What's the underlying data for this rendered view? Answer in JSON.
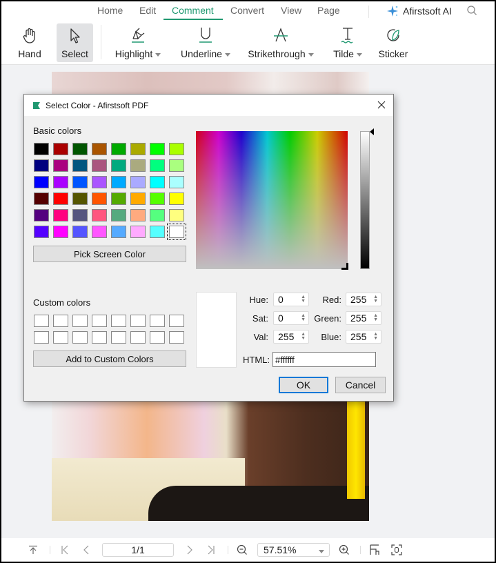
{
  "menu_tabs": [
    {
      "label": "Home",
      "active": false
    },
    {
      "label": "Edit",
      "active": false
    },
    {
      "label": "Comment",
      "active": true
    },
    {
      "label": "Convert",
      "active": false
    },
    {
      "label": "View",
      "active": false
    },
    {
      "label": "Page",
      "active": false
    }
  ],
  "ai_button": {
    "label": "Afirstsoft AI",
    "icon": "sparkle-icon"
  },
  "search_icon": "search-icon",
  "ribbon": [
    {
      "label": "Hand",
      "icon": "hand-icon",
      "dropdown": false,
      "selected": false
    },
    {
      "label": "Select",
      "icon": "cursor-icon",
      "dropdown": false,
      "selected": true
    },
    {
      "label": "Highlight",
      "icon": "highlighter-icon",
      "dropdown": true,
      "selected": false
    },
    {
      "label": "Underline",
      "icon": "underline-icon",
      "dropdown": true,
      "selected": false
    },
    {
      "label": "Strikethrough",
      "icon": "strikethrough-icon",
      "dropdown": true,
      "selected": false
    },
    {
      "label": "Tilde",
      "icon": "tilde-icon",
      "dropdown": true,
      "selected": false
    },
    {
      "label": "Sticker",
      "icon": "sticker-icon",
      "dropdown": false,
      "selected": false
    }
  ],
  "accent_color": "#1f9870",
  "dialog": {
    "title": "Select Color - Afirstsoft PDF",
    "basic_colors_label": "Basic colors",
    "basic_colors": [
      [
        "#000000",
        "#aa0000",
        "#005500",
        "#aa5500",
        "#00aa00",
        "#aaaa00",
        "#00ff00",
        "#aaff00"
      ],
      [
        "#00007f",
        "#aa007f",
        "#00557f",
        "#aa557f",
        "#00aa7f",
        "#aaaa7f",
        "#00ff7f",
        "#aaff7f"
      ],
      [
        "#0000ff",
        "#aa00ff",
        "#0055ff",
        "#aa55ff",
        "#00aaff",
        "#aaaaff",
        "#00ffff",
        "#aaffff"
      ],
      [
        "#550000",
        "#ff0000",
        "#555500",
        "#ff5500",
        "#55aa00",
        "#ffaa00",
        "#55ff00",
        "#ffff00"
      ],
      [
        "#55007f",
        "#ff007f",
        "#55557f",
        "#ff557f",
        "#55aa7f",
        "#ffaa7f",
        "#55ff7f",
        "#ffff7f"
      ],
      [
        "#5500ff",
        "#ff00ff",
        "#5555ff",
        "#ff55ff",
        "#55aaff",
        "#ffaaff",
        "#55ffff",
        "#ffffff"
      ]
    ],
    "selected_basic": [
      5,
      7
    ],
    "pick_screen_label": "Pick Screen Color",
    "custom_colors_label": "Custom colors",
    "custom_colors": [
      [
        "#ffffff",
        "#ffffff",
        "#ffffff",
        "#ffffff",
        "#ffffff",
        "#ffffff",
        "#ffffff",
        "#ffffff"
      ],
      [
        "#ffffff",
        "#ffffff",
        "#ffffff",
        "#ffffff",
        "#ffffff",
        "#ffffff",
        "#ffffff",
        "#ffffff"
      ]
    ],
    "add_custom_label": "Add to Custom Colors",
    "preview_color": "#ffffff",
    "fields": {
      "hue": {
        "label": "Hue:",
        "value": "0"
      },
      "sat": {
        "label": "Sat:",
        "value": "0"
      },
      "val": {
        "label": "Val:",
        "value": "255"
      },
      "red": {
        "label": "Red:",
        "value": "255"
      },
      "green": {
        "label": "Green:",
        "value": "255"
      },
      "blue": {
        "label": "Blue:",
        "value": "255"
      }
    },
    "html_label": "HTML:",
    "html_value": "#ffffff",
    "ok_label": "OK",
    "cancel_label": "Cancel"
  },
  "bottom_bar": {
    "page_value": "1/1",
    "zoom_value": "57.51%"
  }
}
